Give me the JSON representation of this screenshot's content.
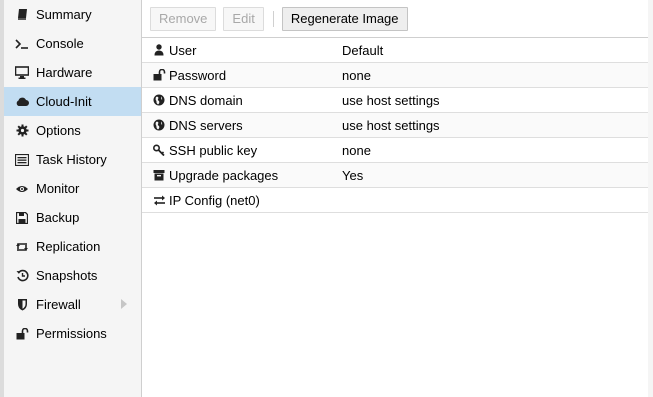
{
  "sidebar": {
    "items": [
      {
        "label": "Summary",
        "icon": "book-icon"
      },
      {
        "label": "Console",
        "icon": "terminal-icon"
      },
      {
        "label": "Hardware",
        "icon": "monitor-icon"
      },
      {
        "label": "Cloud-Init",
        "icon": "cloud-icon"
      },
      {
        "label": "Options",
        "icon": "gear-icon"
      },
      {
        "label": "Task History",
        "icon": "list-icon"
      },
      {
        "label": "Monitor",
        "icon": "eye-icon"
      },
      {
        "label": "Backup",
        "icon": "floppy-icon"
      },
      {
        "label": "Replication",
        "icon": "retweet-icon"
      },
      {
        "label": "Snapshots",
        "icon": "history-icon"
      },
      {
        "label": "Firewall",
        "icon": "shield-icon"
      },
      {
        "label": "Permissions",
        "icon": "unlock-icon"
      }
    ],
    "active": "Cloud-Init"
  },
  "toolbar": {
    "remove_label": "Remove",
    "edit_label": "Edit",
    "regenerate_label": "Regenerate Image"
  },
  "cloudinit": {
    "rows": [
      {
        "key": "User",
        "value": "Default",
        "icon": "user-icon"
      },
      {
        "key": "Password",
        "value": "none",
        "icon": "unlock-icon"
      },
      {
        "key": "DNS domain",
        "value": "use host settings",
        "icon": "globe-icon"
      },
      {
        "key": "DNS servers",
        "value": "use host settings",
        "icon": "globe-icon"
      },
      {
        "key": "SSH public key",
        "value": "none",
        "icon": "key-icon"
      },
      {
        "key": "Upgrade packages",
        "value": "Yes",
        "icon": "archive-icon"
      },
      {
        "key": "IP Config (net0)",
        "value": "",
        "icon": "exchange-icon"
      }
    ]
  },
  "colors": {
    "active_bg": "#c2ddf2",
    "sidebar_bg": "#f5f5f5",
    "border": "#cfcfcf"
  }
}
